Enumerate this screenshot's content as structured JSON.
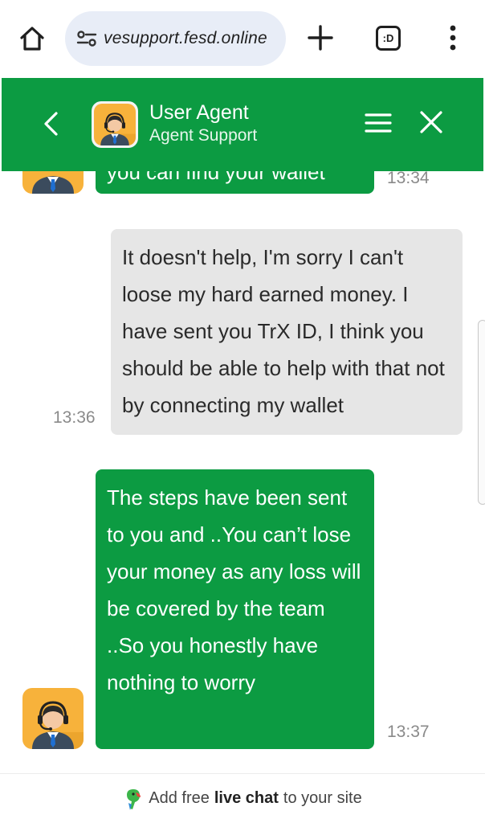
{
  "browser": {
    "url": "vesupport.fesd.online",
    "tabs_label": ":D",
    "icons": [
      "home-icon",
      "site-settings-icon",
      "plus-icon",
      "tabs-icon",
      "kebab-menu-icon"
    ]
  },
  "header": {
    "agent_name": "User Agent",
    "agent_role": "Agent Support",
    "icons": [
      "chevron-left-icon",
      "hamburger-icon",
      "close-icon"
    ],
    "color": "#0c9b42"
  },
  "messages": [
    {
      "from": "agent",
      "text": "you can find your wallet",
      "time": "13:34"
    },
    {
      "from": "user",
      "text": "It doesn't help, I'm sorry I can't loose my hard earned money. I have sent you TrX ID, I think you should be able to help with that not by connecting my wallet",
      "time": "13:36"
    },
    {
      "from": "agent",
      "text": "The steps have been sent to you and ..You can’t lose your money as any loss will be covered by the team ..So you honestly have nothing to worry",
      "time": "13:37"
    }
  ],
  "footer": {
    "prefix": "Add free",
    "bold": "live chat",
    "suffix": "to your site"
  },
  "colors": {
    "agent_bubble": "#0c9b42",
    "user_bubble": "#e6e6e6",
    "avatar_bg": "#f7b23b"
  }
}
